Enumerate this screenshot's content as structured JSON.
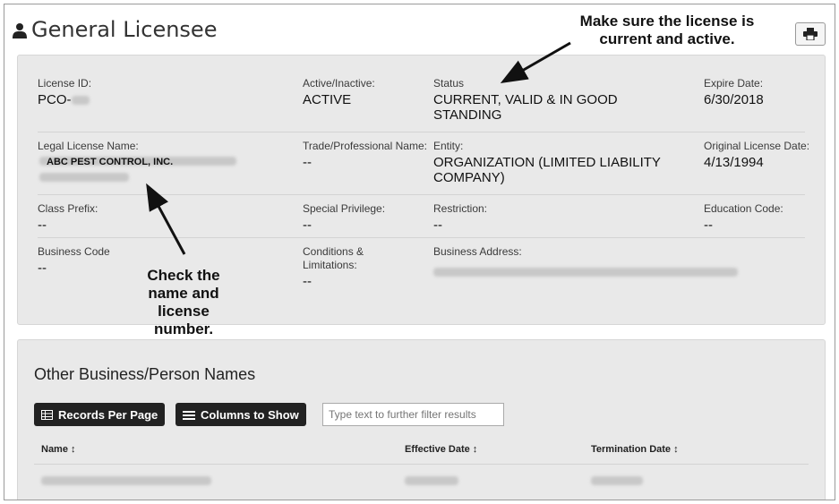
{
  "header": {
    "title": "General Licensee",
    "user_icon": "user-icon",
    "print_icon": "print-icon"
  },
  "fields": {
    "license_id": {
      "label": "License ID:",
      "value": "PCO-"
    },
    "active": {
      "label": "Active/Inactive:",
      "value": "ACTIVE"
    },
    "status": {
      "label": "Status",
      "value": "CURRENT, VALID & IN GOOD STANDING"
    },
    "expire": {
      "label": "Expire Date:",
      "value": "6/30/2018"
    },
    "legal_name": {
      "label": "Legal License Name:",
      "value": "ABC PEST CONTROL, INC."
    },
    "trade_name": {
      "label": "Trade/Professional Name:",
      "value": "--"
    },
    "entity": {
      "label": "Entity:",
      "value": "ORGANIZATION (LIMITED LIABILITY COMPANY)"
    },
    "orig_date": {
      "label": "Original License Date:",
      "value": "4/13/1994"
    },
    "class_prefix": {
      "label": "Class Prefix:",
      "value": "--"
    },
    "special_privilege": {
      "label": "Special Privilege:",
      "value": "--"
    },
    "restriction": {
      "label": "Restriction:",
      "value": "--"
    },
    "education_code": {
      "label": "Education Code:",
      "value": "--"
    },
    "business_code": {
      "label": "Business Code",
      "value": "--"
    },
    "conditions": {
      "label": "Conditions & Limitations:",
      "value": "--"
    },
    "business_address": {
      "label": "Business Address:"
    }
  },
  "other_names": {
    "title": "Other Business/Person Names",
    "records_btn": "Records Per Page",
    "columns_btn": "Columns to Show",
    "filter_placeholder": "Type text to further filter results",
    "columns": [
      "Name ↕",
      "Effective Date ↕",
      "Termination Date ↕"
    ]
  },
  "annotations": {
    "top_note": "Make sure the license is current and active.",
    "bottom_note": "Check the name and license number."
  }
}
